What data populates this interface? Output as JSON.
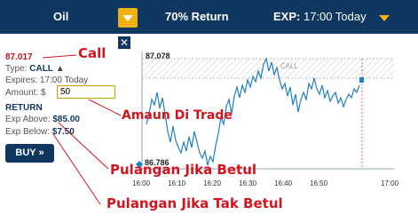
{
  "header": {
    "asset": "Oil",
    "return_label": "70% Return",
    "expiry_prefix": "EXP:",
    "expiry_value": "17:00 Today"
  },
  "trade_panel": {
    "current_price": "87.017",
    "type_label": "Type:",
    "type_value": "CALL",
    "expires_label": "Expires: 17:00 Today",
    "amount_label": "Amount: $",
    "amount_value": "50",
    "return_heading": "RETURN",
    "exp_above_label": "Exp Above:",
    "exp_above_value": "$85.00",
    "exp_below_label": "Exp Below:",
    "exp_below_value": "$7.50",
    "buy_label": "BUY »"
  },
  "chart": {
    "top_price_label": "87.078",
    "bottom_price_label": "86.786",
    "zone_label": "CALL",
    "x_ticks": [
      "16:00",
      "16:10",
      "16:20",
      "16:30",
      "16:40",
      "16:50",
      "17:00"
    ]
  },
  "annotations": {
    "call": "Call",
    "amount": "Amaun Di Trade",
    "payout_win": "Pulangan Jika Betul",
    "payout_lose": "Pulangan Jika Tak Betul"
  },
  "colors": {
    "header_bg": "#10375f",
    "accent": "#f2b00c",
    "annotation": "#d4141c",
    "line": "#1f7fc4"
  }
}
